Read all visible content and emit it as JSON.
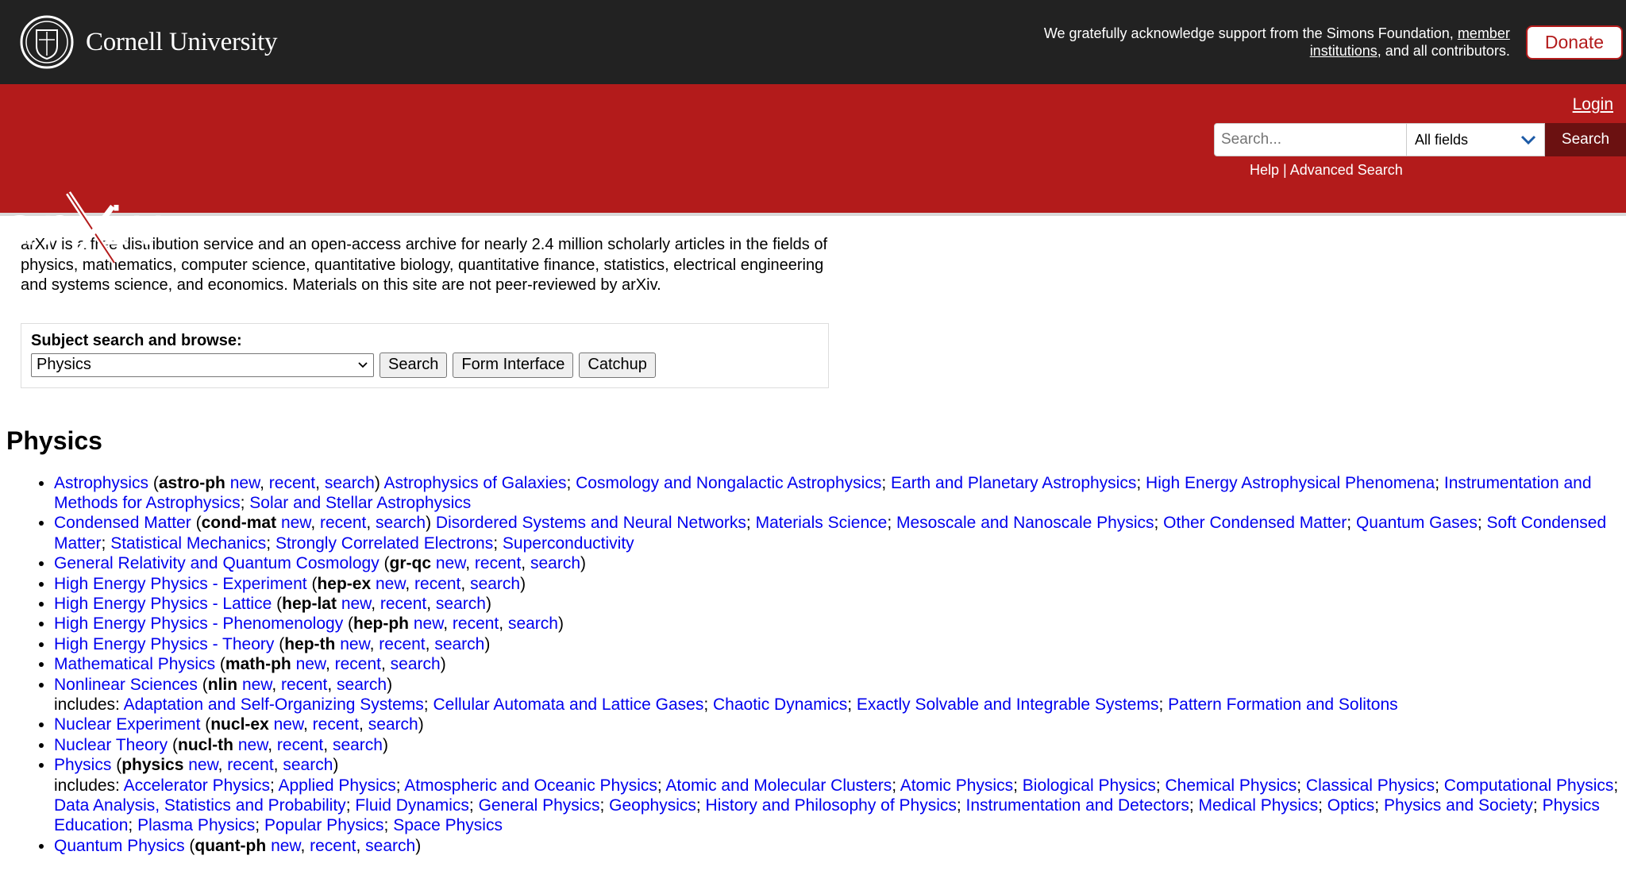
{
  "cornell": {
    "name": "Cornell University",
    "support_prefix": "We gratefully acknowledge support from the Simons Foundation,",
    "member_link": "member institutions",
    "support_suffix": ", and all contributors.",
    "donate": "Donate"
  },
  "header": {
    "login": "Login",
    "search_placeholder": "Search...",
    "field_selected": "All fields",
    "search_button": "Search",
    "help": "Help",
    "separator": " | ",
    "advanced": "Advanced Search"
  },
  "intro": "arXiv is a free distribution service and an open-access archive for nearly 2.4 million scholarly articles in the fields of physics, mathematics, computer science, quantitative biology, quantitative finance, statistics, electrical engineering and systems science, and economics. Materials on this site are not peer-reviewed by arXiv.",
  "subject": {
    "label": "Subject search and browse:",
    "selected": "Physics",
    "search": "Search",
    "form": "Form Interface",
    "catchup": "Catchup"
  },
  "section_title": "Physics",
  "archives": [
    {
      "name": "Astrophysics",
      "code": "astro-ph",
      "subs": [
        "Astrophysics of Galaxies",
        "Cosmology and Nongalactic Astrophysics",
        "Earth and Planetary Astrophysics",
        "High Energy Astrophysical Phenomena",
        "Instrumentation and Methods for Astrophysics",
        "Solar and Stellar Astrophysics"
      ],
      "includes": false
    },
    {
      "name": "Condensed Matter",
      "code": "cond-mat",
      "subs": [
        "Disordered Systems and Neural Networks",
        "Materials Science",
        "Mesoscale and Nanoscale Physics",
        "Other Condensed Matter",
        "Quantum Gases",
        "Soft Condensed Matter",
        "Statistical Mechanics",
        "Strongly Correlated Electrons",
        "Superconductivity"
      ],
      "includes": false
    },
    {
      "name": "General Relativity and Quantum Cosmology",
      "code": "gr-qc",
      "subs": [],
      "includes": false
    },
    {
      "name": "High Energy Physics - Experiment",
      "code": "hep-ex",
      "subs": [],
      "includes": false
    },
    {
      "name": "High Energy Physics - Lattice",
      "code": "hep-lat",
      "subs": [],
      "includes": false
    },
    {
      "name": "High Energy Physics - Phenomenology",
      "code": "hep-ph",
      "subs": [],
      "includes": false
    },
    {
      "name": "High Energy Physics - Theory",
      "code": "hep-th",
      "subs": [],
      "includes": false
    },
    {
      "name": "Mathematical Physics",
      "code": "math-ph",
      "subs": [],
      "includes": false
    },
    {
      "name": "Nonlinear Sciences",
      "code": "nlin",
      "subs": [
        "Adaptation and Self-Organizing Systems",
        "Cellular Automata and Lattice Gases",
        "Chaotic Dynamics",
        "Exactly Solvable and Integrable Systems",
        "Pattern Formation and Solitons"
      ],
      "includes": true
    },
    {
      "name": "Nuclear Experiment",
      "code": "nucl-ex",
      "subs": [],
      "includes": false
    },
    {
      "name": "Nuclear Theory",
      "code": "nucl-th",
      "subs": [],
      "includes": false
    },
    {
      "name": "Physics",
      "code": "physics",
      "subs": [
        "Accelerator Physics",
        "Applied Physics",
        "Atmospheric and Oceanic Physics",
        "Atomic and Molecular Clusters",
        "Atomic Physics",
        "Biological Physics",
        "Chemical Physics",
        "Classical Physics",
        "Computational Physics",
        "Data Analysis, Statistics and Probability",
        "Fluid Dynamics",
        "General Physics",
        "Geophysics",
        "History and Philosophy of Physics",
        "Instrumentation and Detectors",
        "Medical Physics",
        "Optics",
        "Physics and Society",
        "Physics Education",
        "Plasma Physics",
        "Popular Physics",
        "Space Physics"
      ],
      "includes": true
    },
    {
      "name": "Quantum Physics",
      "code": "quant-ph",
      "subs": [],
      "includes": false
    }
  ],
  "link_words": {
    "new": "new",
    "recent": "recent",
    "search": "search",
    "includes": "includes:"
  }
}
